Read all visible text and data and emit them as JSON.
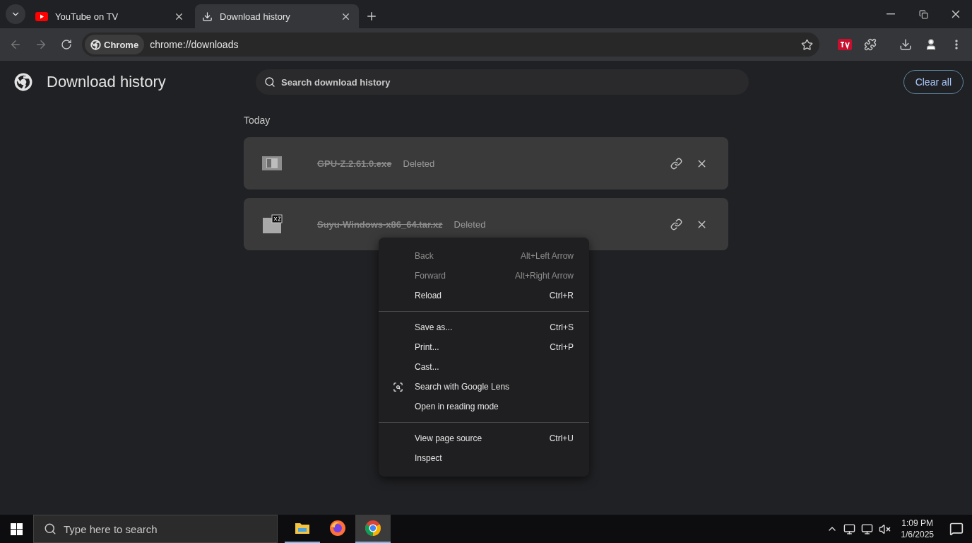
{
  "tabs": [
    {
      "title": "YouTube on TV",
      "kind": "youtube",
      "selected": false
    },
    {
      "title": "Download history",
      "kind": "download",
      "selected": true
    }
  ],
  "address": {
    "chip": "Chrome",
    "url": "chrome://downloads"
  },
  "page": {
    "title": "Download history",
    "search": {
      "placeholder": "Search download history"
    },
    "clear_button": "Clear all",
    "section": "Today",
    "downloads": [
      {
        "name": "GPU-Z.2.61.0.exe",
        "status": "Deleted",
        "removed": true,
        "kind": "exe"
      },
      {
        "name": "Suyu-Windows-x86_64.tar.xz",
        "status": "Deleted",
        "removed": true,
        "kind": "archive"
      }
    ]
  },
  "context_menu": {
    "groups": [
      [
        {
          "label": "Back",
          "shortcut": "Alt+Left Arrow",
          "disabled": true,
          "kind": "plain"
        },
        {
          "label": "Forward",
          "shortcut": "Alt+Right Arrow",
          "disabled": true,
          "kind": "plain"
        },
        {
          "label": "Reload",
          "shortcut": "Ctrl+R",
          "disabled": false,
          "kind": "plain"
        }
      ],
      [
        {
          "label": "Save as...",
          "shortcut": "Ctrl+S",
          "disabled": false,
          "kind": "plain"
        },
        {
          "label": "Print...",
          "shortcut": "Ctrl+P",
          "disabled": false,
          "kind": "plain"
        },
        {
          "label": "Cast...",
          "disabled": false,
          "kind": "plain"
        },
        {
          "label": "Search with Google Lens",
          "disabled": false,
          "kind": "lens"
        },
        {
          "label": "Open in reading mode",
          "disabled": false,
          "kind": "plain"
        }
      ],
      [
        {
          "label": "View page source",
          "shortcut": "Ctrl+U",
          "disabled": false,
          "kind": "plain"
        },
        {
          "label": "Inspect",
          "disabled": false,
          "kind": "plain"
        }
      ]
    ]
  },
  "taskbar": {
    "search_placeholder": "Type here to search",
    "apps": [
      {
        "kind": "explorer",
        "running": true,
        "selected": false
      },
      {
        "kind": "firefox",
        "running": false,
        "selected": false
      },
      {
        "kind": "chrome",
        "running": true,
        "selected": true
      }
    ],
    "time": "1:09 PM",
    "date": "1/6/2025"
  }
}
